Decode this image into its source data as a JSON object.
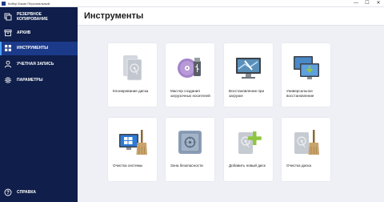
{
  "window": {
    "title": "Кибер Бэкап Персональный",
    "controls": [
      "—",
      "☐",
      "✕"
    ]
  },
  "sidebar": {
    "items": [
      {
        "label": "Резервное копирование",
        "icon": "backup-copy-icon"
      },
      {
        "label": "Архив",
        "icon": "archive-icon"
      },
      {
        "label": "Инструменты",
        "icon": "tools-grid-icon",
        "active": true
      },
      {
        "label": "Учетная запись",
        "icon": "user-account-icon"
      },
      {
        "label": "Параметры",
        "icon": "settings-gear-icon"
      }
    ],
    "help": {
      "label": "Справка",
      "icon": "help-question-icon"
    }
  },
  "main": {
    "title": "Инструменты",
    "tools": [
      {
        "label": "Клонирование диска",
        "icon": "disk-clone-icon"
      },
      {
        "label": "Мастер создания загрузочных носителей",
        "icon": "bootable-media-icon"
      },
      {
        "label": "Восстановление при загрузке",
        "icon": "startup-recovery-icon"
      },
      {
        "label": "Универсальное восстановление",
        "icon": "universal-restore-icon"
      },
      {
        "label": "Очистка системы",
        "icon": "system-clean-icon"
      },
      {
        "label": "Зона безопасности",
        "icon": "secure-zone-icon"
      },
      {
        "label": "Добавить новый диск",
        "icon": "add-disk-icon"
      },
      {
        "label": "Очистка диска",
        "icon": "disk-clean-icon"
      }
    ]
  },
  "colors": {
    "sidebar_bg": "#0f1e4a",
    "sidebar_active": "#1c3a8a",
    "accent": "#4a9eff",
    "content_bg": "#eef0f5",
    "card_bg": "#ffffff",
    "green_plus": "#8fc63f"
  }
}
